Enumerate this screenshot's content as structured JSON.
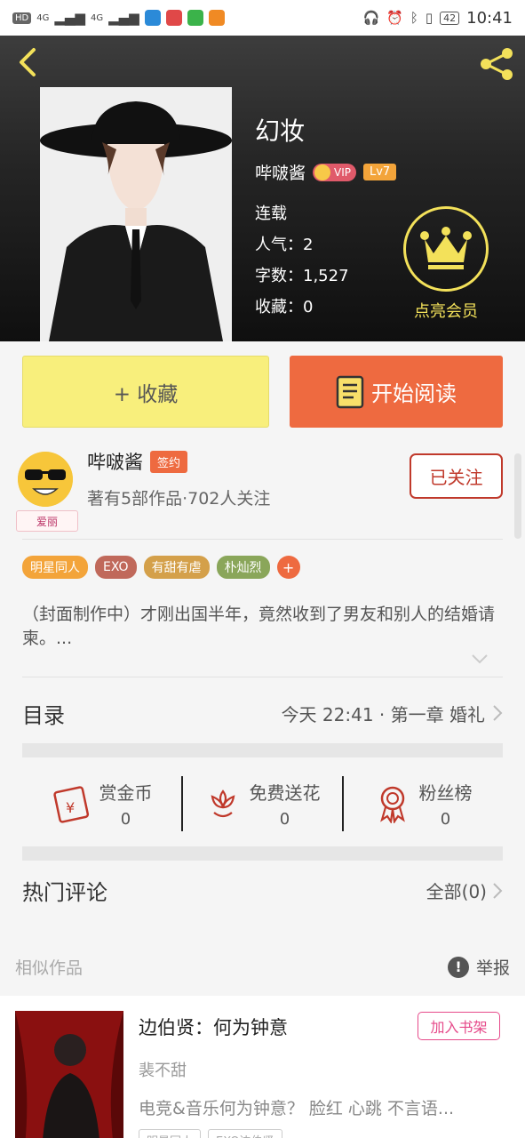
{
  "statusbar": {
    "network_chip": "HD",
    "signal1": "4G",
    "signal2": "4G",
    "battery": "42",
    "time": "10:41"
  },
  "book": {
    "title": "幻妆",
    "author": "哔啵酱",
    "vip": "VIP",
    "level": "Lv7",
    "status": "连载",
    "popularity": "人气：2",
    "word_count": "字数：1,527",
    "favorites": "收藏：0",
    "member_label": "点亮会员"
  },
  "actions": {
    "fav_label": "+ 收藏",
    "read_label": "开始阅读"
  },
  "author_block": {
    "name": "哔啵酱",
    "sign_badge": "签约",
    "avatar_badge": "爱丽",
    "summary": "著有5部作品·702人关注",
    "follow_label": "已关注"
  },
  "tags": [
    {
      "label": "明星同人",
      "color": "#f3a43a"
    },
    {
      "label": "EXO",
      "color": "#c0695b"
    },
    {
      "label": "有甜有虐",
      "color": "#d4a04a"
    },
    {
      "label": "朴灿烈",
      "color": "#8aa65a"
    }
  ],
  "tag_add": "+",
  "description": "（封面制作中）才刚出国半年，竟然收到了男友和别人的结婚请柬。...",
  "toc": {
    "label": "目录",
    "latest": "今天 22:41 · 第一章 婚礼"
  },
  "stats": [
    {
      "name": "赏金币",
      "value": "0",
      "icon": "red-envelope-icon"
    },
    {
      "name": "免费送花",
      "value": "0",
      "icon": "flower-icon"
    },
    {
      "name": "粉丝榜",
      "value": "0",
      "icon": "medal-icon"
    }
  ],
  "hot_comments": {
    "label": "热门评论",
    "all": "全部(0)"
  },
  "similar": {
    "label": "相似作品",
    "report": "举报",
    "card": {
      "title": "边伯贤：何为钟意",
      "author": "裴不甜",
      "desc": "电竞&音乐何为钟意？ 脸红 心跳 不言语...",
      "add_label": "加入书架",
      "tags": [
        "明星同人",
        "EXO边伯贤"
      ]
    }
  },
  "colors": {
    "accent": "#ee6a40",
    "fav_yellow": "#f8ef7c",
    "crown": "#f3e15a",
    "follow_red": "#c0392b"
  }
}
